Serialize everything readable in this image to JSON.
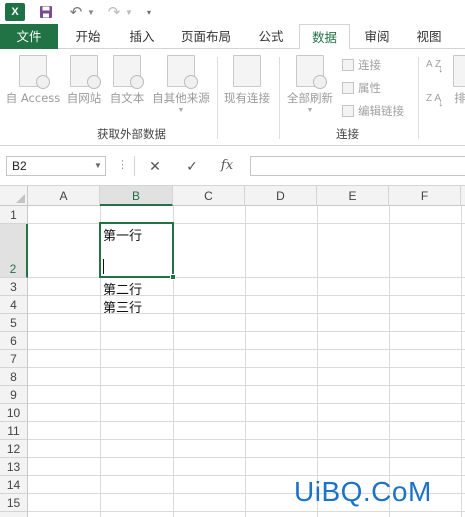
{
  "qat": {
    "logo_text": "X"
  },
  "tabs": [
    {
      "label": "文件"
    },
    {
      "label": "开始"
    },
    {
      "label": "插入"
    },
    {
      "label": "页面布局"
    },
    {
      "label": "公式"
    },
    {
      "label": "数据"
    },
    {
      "label": "审阅"
    },
    {
      "label": "视图"
    }
  ],
  "ribbon": {
    "get_external_data": {
      "buttons": [
        {
          "label": "自 Access"
        },
        {
          "label": "自网站"
        },
        {
          "label": "自文本"
        },
        {
          "label": "自其他来源"
        }
      ],
      "group_label": "获取外部数据"
    },
    "existing_connections": {
      "label": "现有连接"
    },
    "connections": {
      "refresh_all": "全部刷新",
      "small": [
        {
          "label": "连接"
        },
        {
          "label": "属性"
        },
        {
          "label": "编辑链接"
        }
      ],
      "group_label": "连接"
    },
    "sort": {
      "az": "A Z",
      "za": "Z A",
      "sort_label": "排"
    }
  },
  "formula_bar": {
    "name_box": "B2",
    "value": ""
  },
  "sheet": {
    "columns": [
      "A",
      "B",
      "C",
      "D",
      "E",
      "F"
    ],
    "rows": [
      "1",
      "2",
      "3",
      "4",
      "5",
      "6",
      "7",
      "8",
      "9",
      "10",
      "11",
      "12",
      "13",
      "14",
      "15"
    ],
    "selected_cell": "B2",
    "cells": {
      "B2_line1": "第一行",
      "B3": "第二行",
      "B4": "第三行"
    }
  },
  "watermark": "UiBQ.CoM"
}
